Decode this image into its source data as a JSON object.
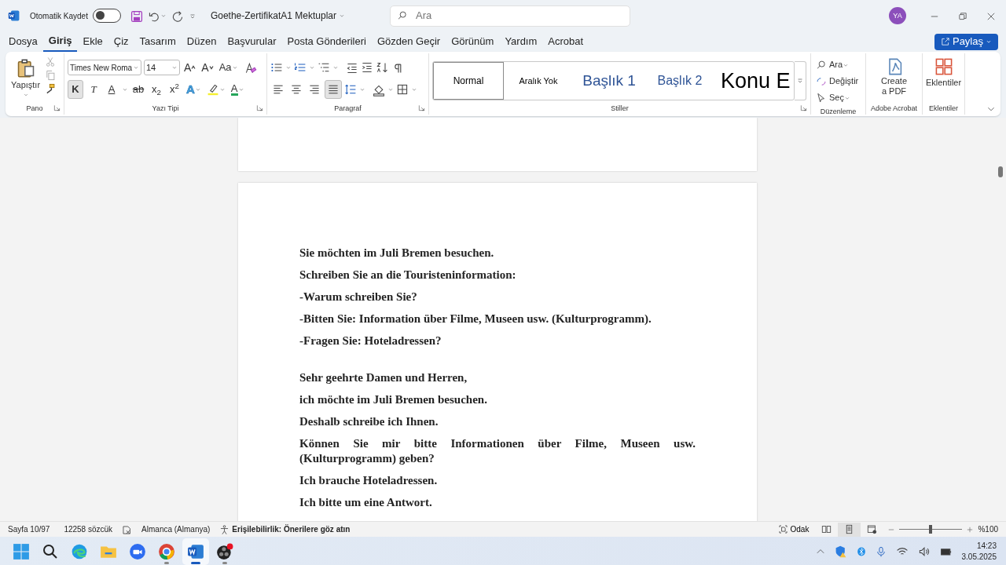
{
  "title_bar": {
    "autosave_label": "Otomatik Kaydet",
    "autosave_on": false,
    "document_title": "Goethe-ZertifikatA1 Mektuplar",
    "search_placeholder": "Ara",
    "avatar_initials": "YA"
  },
  "menu_tabs": [
    {
      "label": "Dosya",
      "selected": false
    },
    {
      "label": "Giriş",
      "selected": true
    },
    {
      "label": "Ekle",
      "selected": false
    },
    {
      "label": "Çiz",
      "selected": false
    },
    {
      "label": "Tasarım",
      "selected": false
    },
    {
      "label": "Düzen",
      "selected": false
    },
    {
      "label": "Başvurular",
      "selected": false
    },
    {
      "label": "Posta Gönderileri",
      "selected": false
    },
    {
      "label": "Gözden Geçir",
      "selected": false
    },
    {
      "label": "Görünüm",
      "selected": false
    },
    {
      "label": "Yardım",
      "selected": false
    },
    {
      "label": "Acrobat",
      "selected": false
    }
  ],
  "share_button": "Paylaş",
  "ribbon": {
    "clipboard": {
      "paste_label": "Yapıştır",
      "group_label": "Pano"
    },
    "font": {
      "group_label": "Yazı Tipi",
      "font_name": "Times New Roma",
      "font_size": "14",
      "size_buttons": [
        {
          "label": "A",
          "kind": "grow"
        },
        {
          "label": "A",
          "kind": "shrink"
        },
        {
          "label": "Aa",
          "kind": "case"
        }
      ],
      "format_buttons": [
        {
          "label": "K",
          "kind": "bold",
          "selected": true
        },
        {
          "label": "T",
          "kind": "italic",
          "selected": false
        },
        {
          "label": "A",
          "kind": "underline",
          "selected": false
        },
        {
          "label": "ab",
          "kind": "strike",
          "selected": false
        },
        {
          "label": "x$_{2}$",
          "kind": "sub",
          "selected": false
        },
        {
          "label": "x$^{2}$",
          "kind": "sup",
          "selected": false
        }
      ],
      "color_buttons": [
        {
          "label": "A",
          "kind": "effects"
        },
        {
          "kind": "highlight"
        },
        {
          "label": "A",
          "kind": "color"
        }
      ]
    },
    "paragraph": {
      "group_label": "Paragraf",
      "alignments": [
        {
          "kind": "left",
          "selected": false
        },
        {
          "kind": "center",
          "selected": false
        },
        {
          "kind": "right",
          "selected": false
        },
        {
          "kind": "justify",
          "selected": true
        }
      ]
    },
    "styles": {
      "group_label": "Stiller",
      "items": [
        {
          "label": "Normal",
          "kind": "normal",
          "selected": true
        },
        {
          "label": "Aralık Yok",
          "kind": "nospacing",
          "selected": false
        },
        {
          "label": "Başlık 1",
          "kind": "heading1",
          "selected": false
        },
        {
          "label": "Başlık 2",
          "kind": "heading2",
          "selected": false
        },
        {
          "label": "Konu E",
          "kind": "title",
          "selected": false
        }
      ]
    },
    "editing": {
      "group_label": "Düzenleme",
      "items": [
        {
          "label": "Ara",
          "kind": "find"
        },
        {
          "label": "Değiştir",
          "kind": "replace"
        },
        {
          "label": "Seç",
          "kind": "select"
        }
      ]
    },
    "acrobat": {
      "group_label": "Adobe Acrobat",
      "button": "Create a PDF"
    },
    "addins": {
      "group_label": "Eklentiler",
      "button": "Eklentiler"
    }
  },
  "document": {
    "sections": [
      {
        "paragraphs": [
          "Sie möchten im Juli Bremen besuchen.",
          "Schreiben Sie an die Touristeninformation:",
          "-Warum schreiben Sie?",
          "-Bitten Sie: Information über Filme, Museen usw. (Kulturprogramm).",
          "-Fragen Sie: Hoteladressen?"
        ]
      },
      {
        "paragraphs": [
          "Sehr geehrte Damen und Herren,",
          "ich möchte im Juli Bremen besuchen.",
          "Deshalb schreibe ich Ihnen.",
          "Können Sie mir bitte Informationen über Filme, Museen usw. (Kulturprogramm) geben?",
          "Ich brauche Hoteladressen.",
          "Ich bitte um eine Antwort."
        ]
      }
    ]
  },
  "status_bar": {
    "page": "Sayfa 10/97",
    "words": "12258 sözcük",
    "language": "Almanca (Almanya)",
    "accessibility": "Erişilebilirlik: Önerilere göz atın",
    "focus": "Odak",
    "views": [
      {
        "kind": "read",
        "selected": false
      },
      {
        "kind": "print",
        "selected": true
      },
      {
        "kind": "web",
        "selected": false
      }
    ],
    "zoom": {
      "level": 0.5,
      "reading": "%100"
    }
  },
  "taskbar": {
    "apps": [
      {
        "kind": "start",
        "running": false,
        "active": false
      },
      {
        "kind": "search",
        "running": false,
        "active": false
      },
      {
        "kind": "edge",
        "running": false,
        "active": false
      },
      {
        "kind": "files",
        "running": false,
        "active": false
      },
      {
        "kind": "zoom",
        "running": false,
        "active": false
      },
      {
        "kind": "chrome",
        "running": true,
        "active": false
      },
      {
        "kind": "word",
        "running": true,
        "active": true
      },
      {
        "kind": "obs",
        "running": true,
        "active": false
      }
    ],
    "time": "14:23",
    "date": "3.05.2025"
  }
}
